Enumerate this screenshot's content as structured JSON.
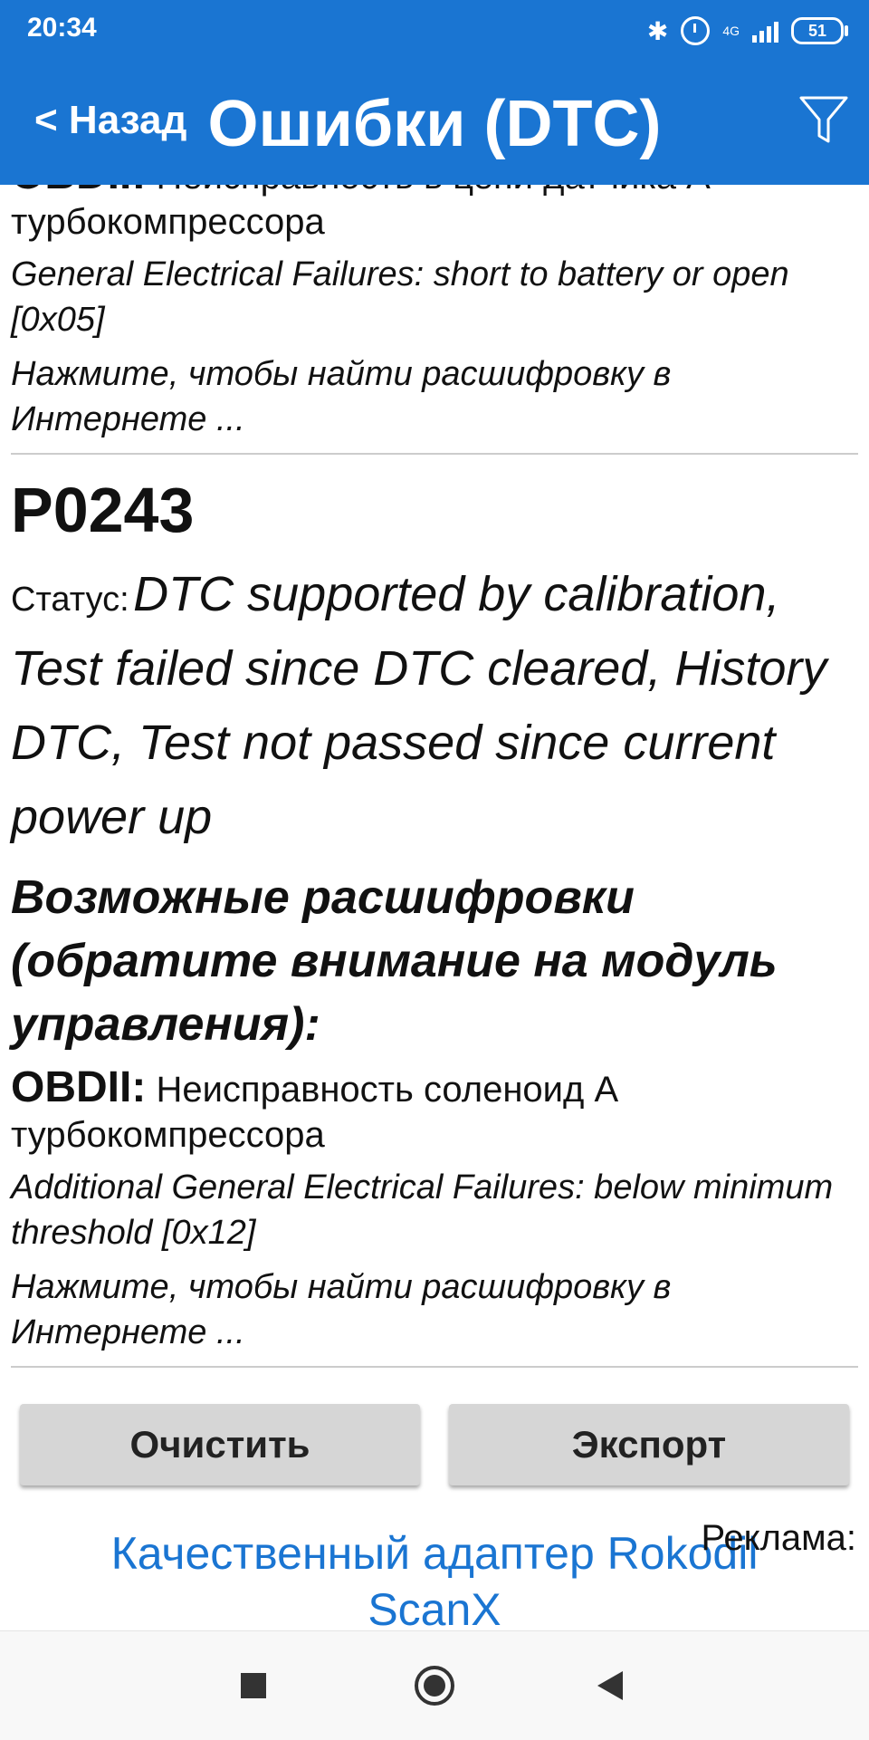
{
  "status_bar": {
    "time": "20:34",
    "network": "4G",
    "battery": "51"
  },
  "header": {
    "back_label": "< Назад",
    "title": "Ошибки (DTC)"
  },
  "entries": [
    {
      "obd_label": "OBDII:",
      "obd_desc": "Неисправность в цепи датчика A турбокомпрессора",
      "failure": "General Electrical Failures: short to battery or open [0x05]",
      "link": "Нажмите, чтобы найти расшифровку в Интернете ..."
    }
  ],
  "dtc": {
    "code": "P0243",
    "status_label": "Статус:",
    "status_value": "DTC supported by calibration, Test failed since DTC cleared, History DTC, Test not passed since current power up",
    "possible_heading": "Возможные расшифровки (обратите внимание на модуль управления):",
    "obd_label": "OBDII:",
    "obd_desc": "Неисправность соленоид A турбокомпрессора",
    "failure": "Additional General Electrical Failures: below minimum threshold [0x12]",
    "link": "Нажмите, чтобы найти расшифровку в Интернете ..."
  },
  "buttons": {
    "clear": "Очистить",
    "export": "Экспорт"
  },
  "ad": {
    "link_text": "Качественный адаптер Rokodil ScanX",
    "label": "Реклама:"
  },
  "colors": {
    "primary": "#1a75d2",
    "button": "#d6d6d6",
    "link": "#1a75d2"
  }
}
